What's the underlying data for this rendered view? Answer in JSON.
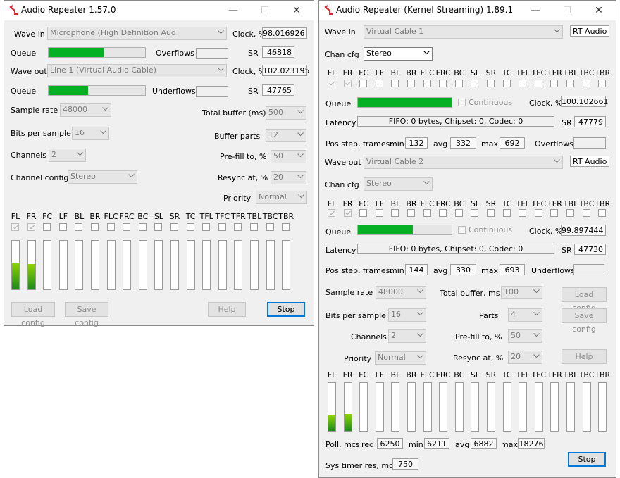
{
  "left": {
    "title": "Audio Repeater 1.57.0",
    "wave_in_label": "Wave in",
    "wave_in_value": "Microphone (High Definition Aud",
    "clock_label": "Clock, %",
    "clock_in_value": "98.016926",
    "queue_label": "Queue",
    "queue_in_fraction": 0.58,
    "overflows_label": "Overflows",
    "sr_label": "SR",
    "sr_in_value": "46818",
    "wave_out_label": "Wave out",
    "wave_out_value": "Line 1 (Virtual Audio Cable)",
    "clock_out_value": "102.023195",
    "queue_out_fraction": 0.41,
    "underflows_label": "Underflows",
    "sr_out_value": "47765",
    "sample_rate_label": "Sample rate",
    "sample_rate_value": "48000",
    "total_buffer_label": "Total buffer (ms)",
    "total_buffer_value": "500",
    "bits_label": "Bits per sample",
    "bits_value": "16",
    "buffer_parts_label": "Buffer parts",
    "buffer_parts_value": "12",
    "channels_label": "Channels",
    "channels_value": "2",
    "prefill_label": "Pre-fill to, %",
    "prefill_value": "50",
    "chcfg_label": "Channel config",
    "chcfg_value": "Stereo",
    "resync_label": "Resync at, %",
    "resync_value": "20",
    "priority_label": "Priority",
    "priority_value": "Normal",
    "channels_list": [
      "FL",
      "FR",
      "FC",
      "LF",
      "BL",
      "BR",
      "FLC",
      "FRC",
      "BC",
      "SL",
      "SR",
      "TC",
      "TFL",
      "TFC",
      "TFR",
      "TBL",
      "TBC",
      "TBR"
    ],
    "checked": [
      true,
      true,
      false,
      false,
      false,
      false,
      false,
      false,
      false,
      false,
      false,
      false,
      false,
      false,
      false,
      false,
      false,
      false
    ],
    "levels": [
      0.55,
      0.52,
      0,
      0,
      0,
      0,
      0,
      0,
      0,
      0,
      0,
      0,
      0,
      0,
      0,
      0,
      0,
      0
    ],
    "load_config": "Load config",
    "save_config": "Save config",
    "help": "Help",
    "stop": "Stop"
  },
  "right": {
    "title": "Audio Repeater (Kernel Streaming) 1.89.1",
    "wave_in_label": "Wave in",
    "wave_in_value": "Virtual Cable 1",
    "rt_in": "RT Audio",
    "chan_cfg_label": "Chan cfg",
    "chan_cfg_in_value": "Stereo",
    "channels_list": [
      "FL",
      "FR",
      "FC",
      "LF",
      "BL",
      "BR",
      "FLC",
      "FRC",
      "BC",
      "SL",
      "SR",
      "TC",
      "TFL",
      "TFC",
      "TFR",
      "TBL",
      "TBC",
      "TBR"
    ],
    "checked": [
      true,
      true,
      false,
      false,
      false,
      false,
      false,
      false,
      false,
      false,
      false,
      false,
      false,
      false,
      false,
      false,
      false,
      false
    ],
    "queue_label": "Queue",
    "queue_in_fraction": 1.0,
    "continuous_label": "Continuous",
    "clock_label": "Clock, %",
    "clock_in_value": "100.102661",
    "latency_label": "Latency",
    "latency_in": "FIFO: 0 bytes, Chipset: 0, Codec: 0",
    "sr_label": "SR",
    "sr_in_value": "47779",
    "pos_step_label": "Pos step, frames:",
    "min_label": "min",
    "avg_label": "avg",
    "max_label": "max",
    "pos_in_min": "132",
    "pos_in_avg": "332",
    "pos_in_max": "692",
    "overflows_label": "Overflows",
    "wave_out_label": "Wave out",
    "wave_out_value": "Virtual Cable 2",
    "rt_out": "RT Audio",
    "chan_cfg_out_value": "Stereo",
    "queue_out_fraction": 0.59,
    "clock_out_value": "99.897444",
    "latency_out": "FIFO: 0 bytes, Chipset: 0, Codec: 0",
    "sr_out_value": "47730",
    "pos_out_min": "144",
    "pos_out_avg": "330",
    "pos_out_max": "693",
    "underflows_label": "Underflows",
    "sample_rate_label": "Sample rate",
    "sample_rate_value": "48000",
    "total_buffer_label": "Total buffer, ms",
    "total_buffer_value": "100",
    "load_config": "Load config",
    "bits_label": "Bits per sample",
    "bits_value": "16",
    "parts_label": "Parts",
    "parts_value": "4",
    "save_config": "Save config",
    "channels_label": "Channels",
    "channels_value": "2",
    "prefill_label": "Pre-fill to, %",
    "prefill_value": "50",
    "priority_label": "Priority",
    "priority_value": "Normal",
    "resync_label": "Resync at, %",
    "resync_value": "20",
    "help": "Help",
    "levels": [
      0.32,
      0.36,
      0,
      0,
      0,
      0,
      0,
      0,
      0,
      0,
      0,
      0,
      0,
      0,
      0,
      0,
      0,
      0
    ],
    "poll_label": "Poll, mcs:",
    "req_label": "req",
    "poll_req": "6250",
    "poll_min": "6211",
    "poll_avg": "6882",
    "poll_max": "18276",
    "sys_timer_label": "Sys timer res, mcs",
    "sys_timer_value": "750",
    "stop": "Stop"
  },
  "colors": {
    "accent": "#0078d7",
    "progress": "#06b025",
    "meter_top": "#8fd400",
    "meter_bottom": "#1c8a1c"
  }
}
